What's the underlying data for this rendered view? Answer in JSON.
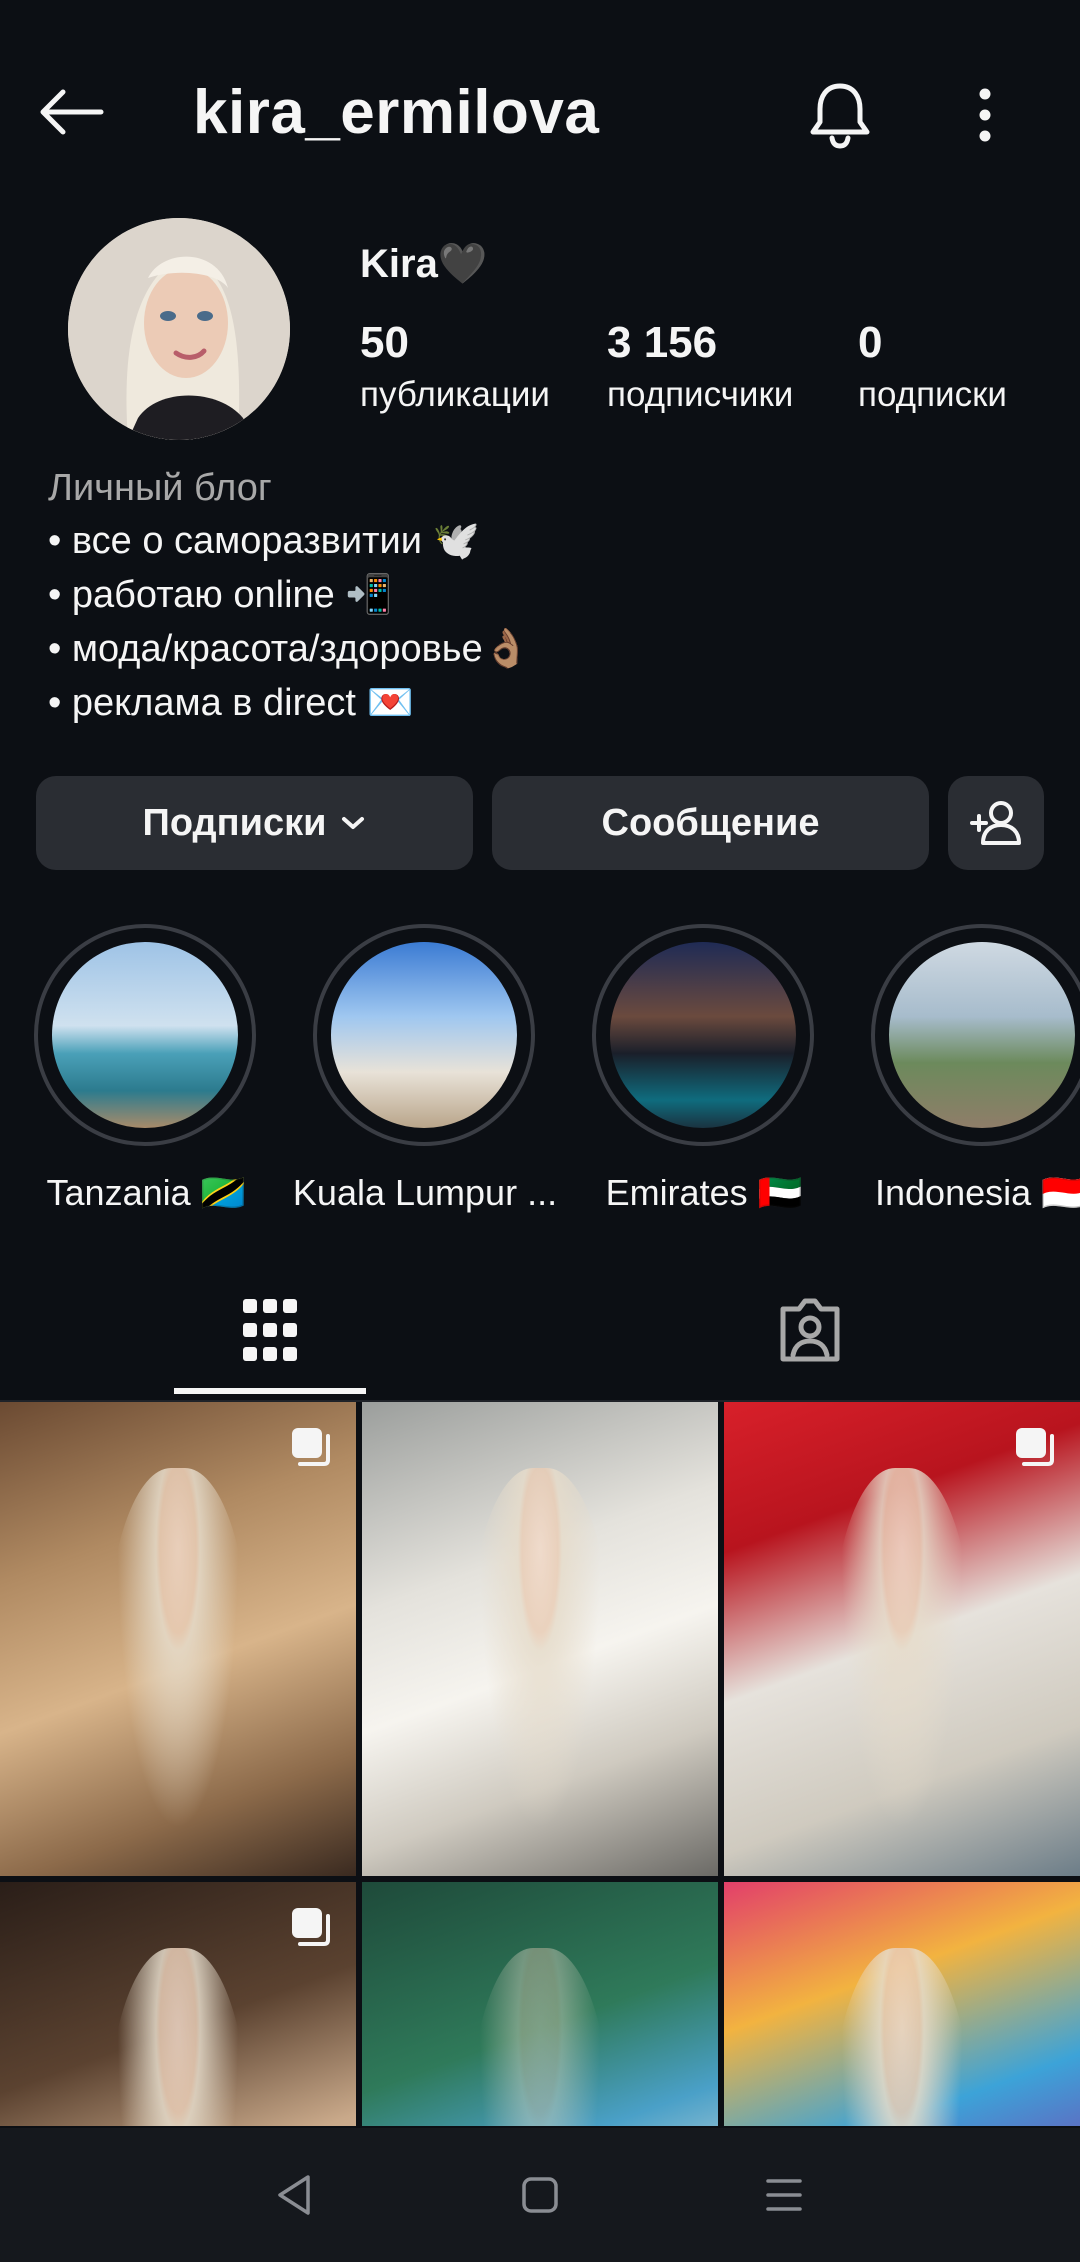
{
  "header": {
    "username": "kira_ermilova"
  },
  "profile": {
    "display_name": "Kira🖤",
    "stats": [
      {
        "value": "50",
        "label": "публикации"
      },
      {
        "value": "3 156",
        "label": "подписчики"
      },
      {
        "value": "0",
        "label": "подписки"
      }
    ],
    "bio": {
      "category": "Личный блог",
      "lines": [
        "• все о саморазвитии 🕊️",
        "• работаю online 📲",
        "• мода/красота/здоровье👌🏽",
        "• реклама в direct 💌"
      ]
    }
  },
  "actions": {
    "following_label": "Подписки",
    "message_label": "Сообщение"
  },
  "highlights": [
    {
      "label": "Tanzania 🇹🇿"
    },
    {
      "label": "Kuala Lumpur ..."
    },
    {
      "label": "Emirates 🇦🇪"
    },
    {
      "label": "Indonesia 🇮🇩"
    }
  ],
  "tabs": {
    "active": "posts-grid"
  },
  "icons": {
    "back": "back-arrow-icon",
    "bell": "bell-icon",
    "more": "more-vertical-icon",
    "add_person": "add-person-icon",
    "grid": "grid-icon",
    "tagged": "tagged-icon",
    "multi_post": "multiple-posts-icon"
  },
  "colors": {
    "background": "#0c0f14",
    "button": "#2a2d33",
    "text": "#f5f5f5",
    "muted": "#a8a8a8"
  }
}
